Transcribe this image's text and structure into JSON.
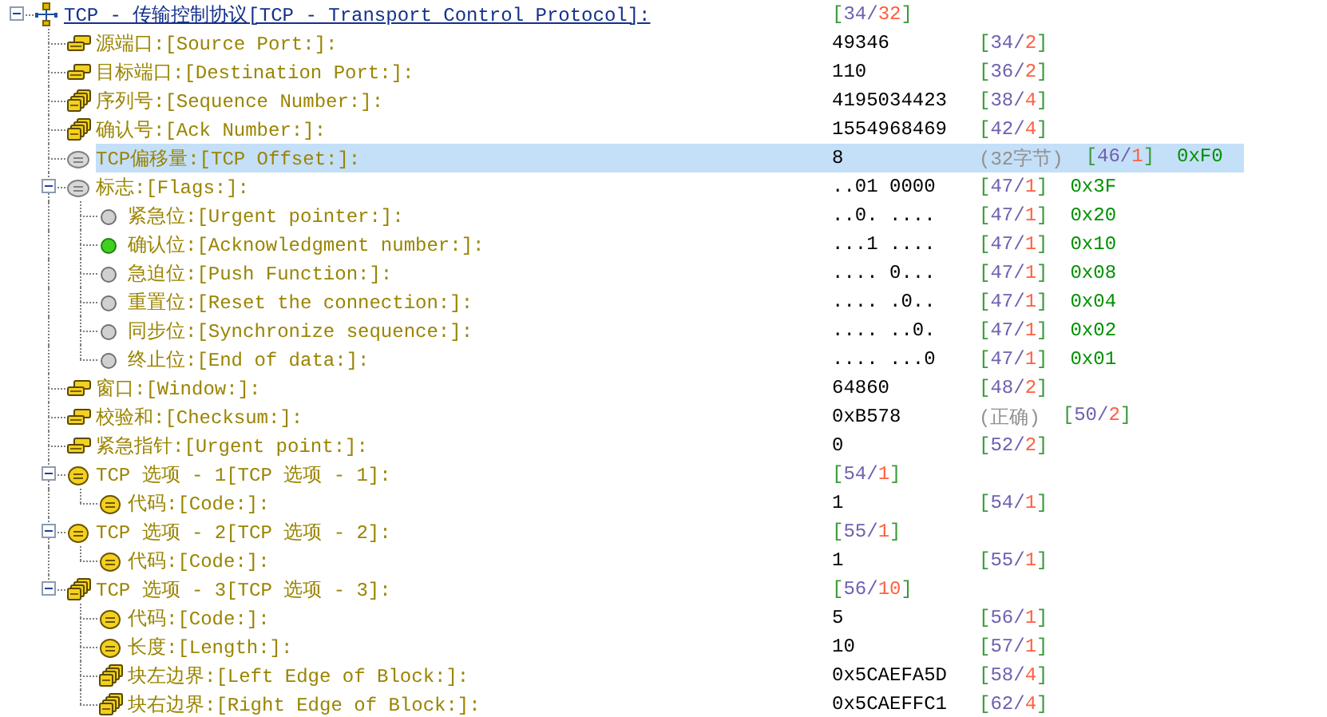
{
  "tree": [
    {
      "kind": "protocol",
      "label": "TCP - 传输控制协议[TCP - Transport Control Protocol]:",
      "range": [
        "[",
        "34",
        "/",
        "32",
        "]"
      ],
      "expanded": true,
      "selected": false,
      "children": [
        {
          "kind": "field2",
          "label": "源端口:[Source Port:]:",
          "value": "49346",
          "range": [
            "[",
            "34",
            "/",
            "2",
            "]"
          ],
          "selected": false
        },
        {
          "kind": "field2",
          "label": "目标端口:[Destination Port:]:",
          "value": "110",
          "range": [
            "[",
            "36",
            "/",
            "2",
            "]"
          ],
          "selected": false
        },
        {
          "kind": "field4",
          "label": "序列号:[Sequence Number:]:",
          "value": "4195034423",
          "range": [
            "[",
            "38",
            "/",
            "4",
            "]"
          ],
          "selected": false
        },
        {
          "kind": "field4",
          "label": "确认号:[Ack Number:]:",
          "value": "1554968469",
          "range": [
            "[",
            "42",
            "/",
            "4",
            "]"
          ],
          "selected": false
        },
        {
          "kind": "disc",
          "label": "TCP偏移量:[TCP Offset:]:",
          "value": "8",
          "note": "(32字节)",
          "range": [
            "[",
            "46",
            "/",
            "1",
            "]"
          ],
          "hex": "0xF0",
          "selected": true
        },
        {
          "kind": "disc",
          "label": "标志:[Flags:]:",
          "value": "..01 0000",
          "range": [
            "[",
            "47",
            "/",
            "1",
            "]"
          ],
          "hex": "0x3F",
          "expanded": true,
          "selected": false,
          "children": [
            {
              "kind": "bit",
              "set": false,
              "label": "紧急位:[Urgent pointer:]:",
              "value": "..0. ....",
              "range": [
                "[",
                "47",
                "/",
                "1",
                "]"
              ],
              "hex": "0x20",
              "selected": false
            },
            {
              "kind": "bit",
              "set": true,
              "label": "确认位:[Acknowledgment number:]:",
              "value": "...1 ....",
              "range": [
                "[",
                "47",
                "/",
                "1",
                "]"
              ],
              "hex": "0x10",
              "selected": false
            },
            {
              "kind": "bit",
              "set": false,
              "label": "急迫位:[Push Function:]:",
              "value": ".... 0...",
              "range": [
                "[",
                "47",
                "/",
                "1",
                "]"
              ],
              "hex": "0x08",
              "selected": false
            },
            {
              "kind": "bit",
              "set": false,
              "label": "重置位:[Reset the connection:]:",
              "value": ".... .0..",
              "range": [
                "[",
                "47",
                "/",
                "1",
                "]"
              ],
              "hex": "0x04",
              "selected": false
            },
            {
              "kind": "bit",
              "set": false,
              "label": "同步位:[Synchronize sequence:]:",
              "value": ".... ..0.",
              "range": [
                "[",
                "47",
                "/",
                "1",
                "]"
              ],
              "hex": "0x02",
              "selected": false
            },
            {
              "kind": "bit",
              "set": false,
              "label": "终止位:[End of data:]:",
              "value": ".... ...0",
              "range": [
                "[",
                "47",
                "/",
                "1",
                "]"
              ],
              "hex": "0x01",
              "selected": false
            }
          ]
        },
        {
          "kind": "field2",
          "label": "窗口:[Window:]:",
          "value": "64860",
          "range": [
            "[",
            "48",
            "/",
            "2",
            "]"
          ],
          "selected": false
        },
        {
          "kind": "field2",
          "label": "校验和:[Checksum:]:",
          "value": "0xB578",
          "note": "(正确)",
          "range": [
            "[",
            "50",
            "/",
            "2",
            "]"
          ],
          "selected": false
        },
        {
          "kind": "field2",
          "label": "紧急指针:[Urgent point:]:",
          "value": "0",
          "range": [
            "[",
            "52",
            "/",
            "2",
            "]"
          ],
          "selected": false
        },
        {
          "kind": "option",
          "label": "TCP 选项 - 1[TCP 选项 - 1]:",
          "range": [
            "[",
            "54",
            "/",
            "1",
            "]"
          ],
          "expanded": true,
          "selected": false,
          "children": [
            {
              "kind": "option",
              "label": "代码:[Code:]:",
              "value": "1",
              "range": [
                "[",
                "54",
                "/",
                "1",
                "]"
              ],
              "selected": false
            }
          ]
        },
        {
          "kind": "option",
          "label": "TCP 选项 - 2[TCP 选项 - 2]:",
          "range": [
            "[",
            "55",
            "/",
            "1",
            "]"
          ],
          "expanded": true,
          "selected": false,
          "children": [
            {
              "kind": "option",
              "label": "代码:[Code:]:",
              "value": "1",
              "range": [
                "[",
                "55",
                "/",
                "1",
                "]"
              ],
              "selected": false
            }
          ]
        },
        {
          "kind": "field4",
          "label": "TCP 选项 - 3[TCP 选项 - 3]:",
          "range": [
            "[",
            "56",
            "/",
            "10",
            "]"
          ],
          "expanded": true,
          "selected": false,
          "children": [
            {
              "kind": "option",
              "label": "代码:[Code:]:",
              "value": "5",
              "range": [
                "[",
                "56",
                "/",
                "1",
                "]"
              ],
              "selected": false
            },
            {
              "kind": "option",
              "label": "长度:[Length:]:",
              "value": "10",
              "range": [
                "[",
                "57",
                "/",
                "1",
                "]"
              ],
              "selected": false
            },
            {
              "kind": "field4",
              "label": "块左边界:[Left Edge of Block:]:",
              "value": "0x5CAEFA5D",
              "range": [
                "[",
                "58",
                "/",
                "4",
                "]"
              ],
              "selected": false
            },
            {
              "kind": "field4",
              "label": "块右边界:[Right Edge of Block:]:",
              "value": "0x5CAEFFC1",
              "range": [
                "[",
                "62",
                "/",
                "4",
                "]"
              ],
              "selected": false
            }
          ]
        }
      ]
    }
  ]
}
